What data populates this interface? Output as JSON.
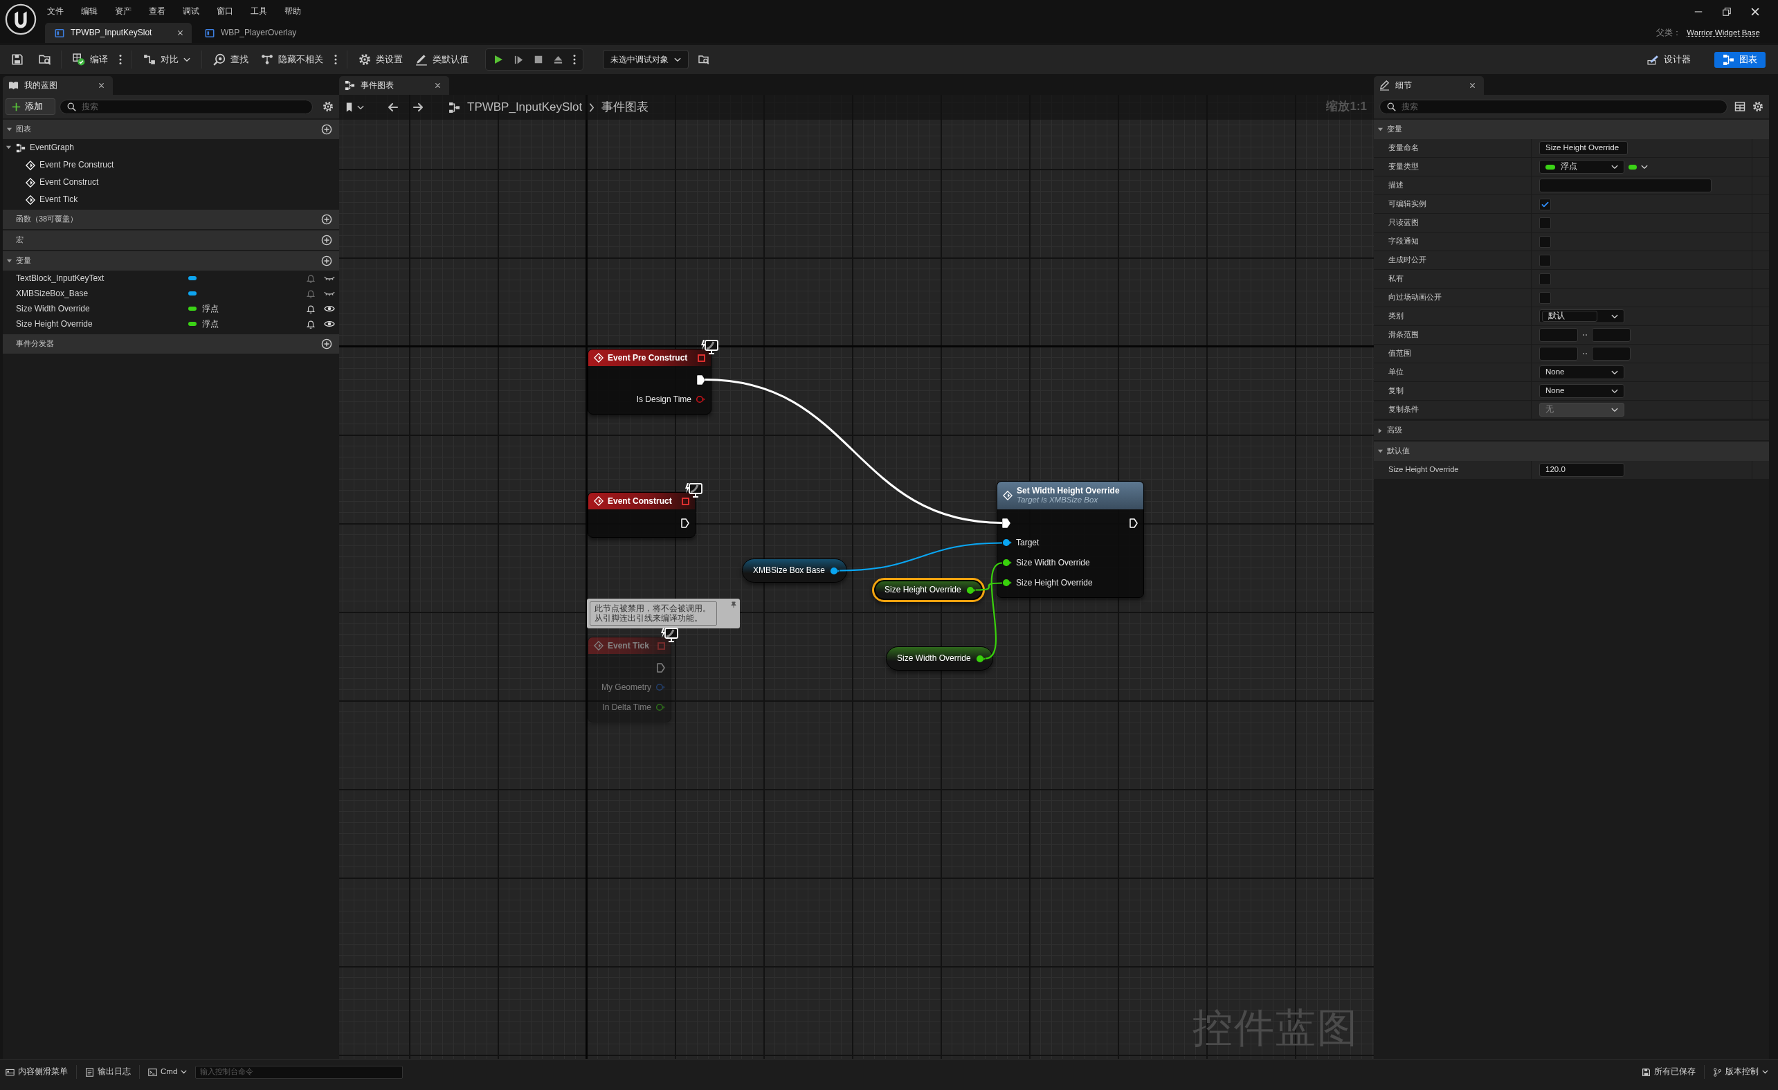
{
  "menu": [
    "文件",
    "编辑",
    "资产",
    "查看",
    "调试",
    "窗口",
    "工具",
    "帮助"
  ],
  "document_tabs": [
    {
      "label": "TPWBP_InputKeySlot",
      "selected": true
    },
    {
      "label": "WBP_PlayerOverlay",
      "selected": false
    }
  ],
  "parent_class": {
    "label": "父类：",
    "value": "Warrior Widget Base"
  },
  "toolbar": {
    "buttons": [
      {
        "label": "编译",
        "more": true,
        "dropdown": false
      },
      {
        "label": "对比",
        "more": false,
        "dropdown": true
      },
      {
        "label": "查找",
        "more": false,
        "dropdown": false
      },
      {
        "label": "隐藏不相关",
        "more": true,
        "dropdown": false
      },
      {
        "label": "类设置",
        "more": false,
        "dropdown": false
      },
      {
        "label": "类默认值",
        "more": false,
        "dropdown": false
      }
    ],
    "debug_object": "未选中调试对象",
    "modes": [
      {
        "label": "设计器",
        "selected": false
      },
      {
        "label": "图表",
        "selected": true
      }
    ]
  },
  "my_blueprint": {
    "title": "我的蓝图",
    "add_button": "添加",
    "search": {
      "placeholder": "搜索"
    },
    "sections": [
      {
        "title": "图表",
        "expanded": true,
        "items": [
          {
            "label": "EventGraph",
            "expanded": true,
            "children": [
              {
                "label": "Event Pre Construct"
              },
              {
                "label": "Event Construct"
              },
              {
                "label": "Event Tick"
              }
            ]
          }
        ]
      },
      {
        "title": "函数（38可覆盖）"
      },
      {
        "title": "宏"
      },
      {
        "title": "变量",
        "expanded": true,
        "variables": [
          {
            "name": "TextBlock_InputKeyText",
            "color": "#0ea5f0",
            "public": false
          },
          {
            "name": "XMBSizeBox_Base",
            "color": "#0ea5f0",
            "public": false
          },
          {
            "name": "Size Width Override",
            "color": "#3bd316",
            "type": "浮点",
            "public": true
          },
          {
            "name": "Size Height Override",
            "color": "#3bd316",
            "type": "浮点",
            "public": true
          }
        ]
      },
      {
        "title": "事件分发器"
      }
    ]
  },
  "graph": {
    "tab": "事件图表",
    "breadcrumb": [
      "TPWBP_InputKeySlot",
      "事件图表"
    ],
    "zoom": "缩放1:1",
    "graph_type": "控件蓝图",
    "nodes": [
      {
        "kind": "event",
        "title": "Event Pre Construct",
        "selected": false,
        "disabled": false,
        "outputs": [
          {
            "kind": "exec",
            "connected": true
          },
          {
            "kind": "boolean",
            "label": "Is Design Time",
            "connected": false
          }
        ]
      },
      {
        "kind": "event",
        "title": "Event Construct",
        "selected": false,
        "disabled": false,
        "outputs": [
          {
            "kind": "exec",
            "connected": false
          }
        ]
      },
      {
        "kind": "event",
        "title": "Event Tick",
        "selected": false,
        "disabled": true,
        "note": "此节点被禁用，将不会被调用。从引脚连出引线来编译功能。",
        "outputs": [
          {
            "kind": "exec",
            "connected": false
          },
          {
            "kind": "structure",
            "label": "My Geometry",
            "connected": false
          },
          {
            "kind": "float",
            "label": "In Delta Time",
            "connected": false
          }
        ]
      },
      {
        "kind": "function",
        "title": "Set Width Height Override",
        "subtitle": "Target is XMBSize Box",
        "selected": false,
        "disabled": false,
        "inputs": [
          {
            "kind": "exec",
            "connected": true
          },
          {
            "kind": "object",
            "label": "Target",
            "connected": true
          },
          {
            "kind": "float",
            "label": "Size Width Override",
            "connected": true
          },
          {
            "kind": "float",
            "label": "Size Height Override",
            "connected": true
          }
        ],
        "outputs": [
          {
            "kind": "exec",
            "connected": false
          }
        ]
      },
      {
        "kind": "variable",
        "title": "XMBSize Box Base",
        "selected": false,
        "disabled": false,
        "outputs": [
          {
            "kind": "object",
            "connected": true
          }
        ]
      },
      {
        "kind": "variable",
        "title": "Size Height Override",
        "selected": true,
        "disabled": false,
        "outputs": [
          {
            "kind": "float",
            "connected": true
          }
        ]
      },
      {
        "kind": "variable",
        "title": "Size Width Override",
        "selected": false,
        "disabled": false,
        "outputs": [
          {
            "kind": "float",
            "connected": true
          }
        ]
      }
    ]
  },
  "details": {
    "title": "细节",
    "search": {
      "placeholder": "搜索"
    },
    "sections": [
      {
        "title": "变量",
        "expanded": true,
        "rows": [
          {
            "label": "变量命名",
            "kind": "text",
            "value": "Size Height Override"
          },
          {
            "label": "变量类型",
            "kind": "type",
            "value": "浮点",
            "color": "#3bd316"
          },
          {
            "label": "描述",
            "kind": "textarea"
          },
          {
            "label": "可编辑实例",
            "kind": "checkbox",
            "checked": true
          },
          {
            "label": "只读蓝图",
            "kind": "checkbox",
            "checked": false
          },
          {
            "label": "字段通知",
            "kind": "checkbox",
            "checked": false
          },
          {
            "label": "生成时公开",
            "kind": "checkbox",
            "checked": false
          },
          {
            "label": "私有",
            "kind": "checkbox",
            "checked": false
          },
          {
            "label": "向过场动画公开",
            "kind": "checkbox",
            "checked": false
          },
          {
            "label": "类别",
            "kind": "combo",
            "value": "默认"
          },
          {
            "label": "滑条范围",
            "kind": "range"
          },
          {
            "label": "值范围",
            "kind": "range"
          },
          {
            "label": "单位",
            "kind": "select",
            "value": "None",
            "disabled": false
          },
          {
            "label": "复制",
            "kind": "select",
            "value": "None",
            "disabled": false
          },
          {
            "label": "复制条件",
            "kind": "select",
            "value": "无",
            "disabled": true
          }
        ]
      },
      {
        "title": "高级",
        "expanded": false
      },
      {
        "title": "默认值",
        "expanded": true,
        "rows": [
          {
            "label": "Size Height Override",
            "kind": "number",
            "value": "120.0"
          }
        ]
      }
    ]
  },
  "status_bar": {
    "left": [
      {
        "label": "内容侧滑菜单",
        "dropdown": false
      },
      {
        "label": "输出日志",
        "dropdown": false
      },
      {
        "label": "Cmd",
        "dropdown": true
      }
    ],
    "console": {
      "placeholder": "输入控制台命令"
    },
    "right": [
      {
        "label": "所有已保存",
        "dropdown": false
      },
      {
        "label": "版本控制",
        "dropdown": true
      }
    ]
  }
}
